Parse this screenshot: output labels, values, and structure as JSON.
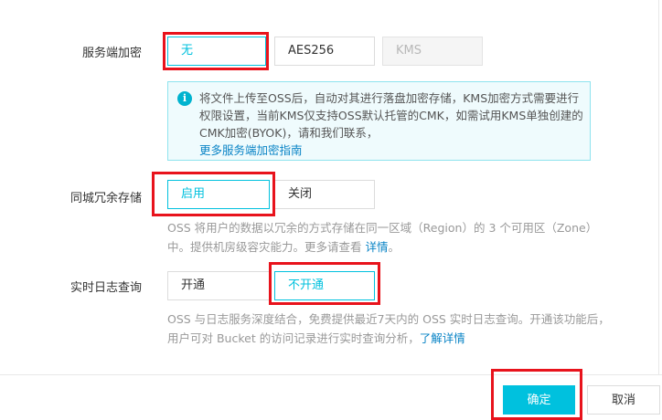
{
  "encryption": {
    "label": "服务端加密",
    "options": [
      "无",
      "AES256",
      "KMS"
    ],
    "selected": "无",
    "info_text": "将文件上传至OSS后，自动对其进行落盘加密存储，KMS加密方式需要进行权限设置，当前KMS仅支持OSS默认托管的CMK，如需试用KMS单独创建的CMK加密(BYOK)，请和我们联系，",
    "info_link": "更多服务端加密指南",
    "info_icon": "info-icon"
  },
  "redundancy": {
    "label": "同城冗余存储",
    "options": [
      "启用",
      "关闭"
    ],
    "selected": "启用",
    "desc": "OSS 将用户的数据以冗余的方式存储在同一区域（Region）的 3 个可用区（Zone）中。提供机房级容灾能力。更多请查看",
    "desc_link": "详情",
    "desc_suffix": "。"
  },
  "log_query": {
    "label": "实时日志查询",
    "options": [
      "开通",
      "不开通"
    ],
    "selected": "不开通",
    "desc": "OSS 与日志服务深度结合，免费提供最近7天内的 OSS 实时日志查询。开通该功能后，用户可对 Bucket 的访问记录进行实时查询分析，",
    "desc_link": "了解详情"
  },
  "footer": {
    "confirm_label": "确定",
    "cancel_label": "取消"
  },
  "colors": {
    "accent": "#00c1de",
    "annotation_red": "#e8131c",
    "link": "#0a84c6"
  }
}
